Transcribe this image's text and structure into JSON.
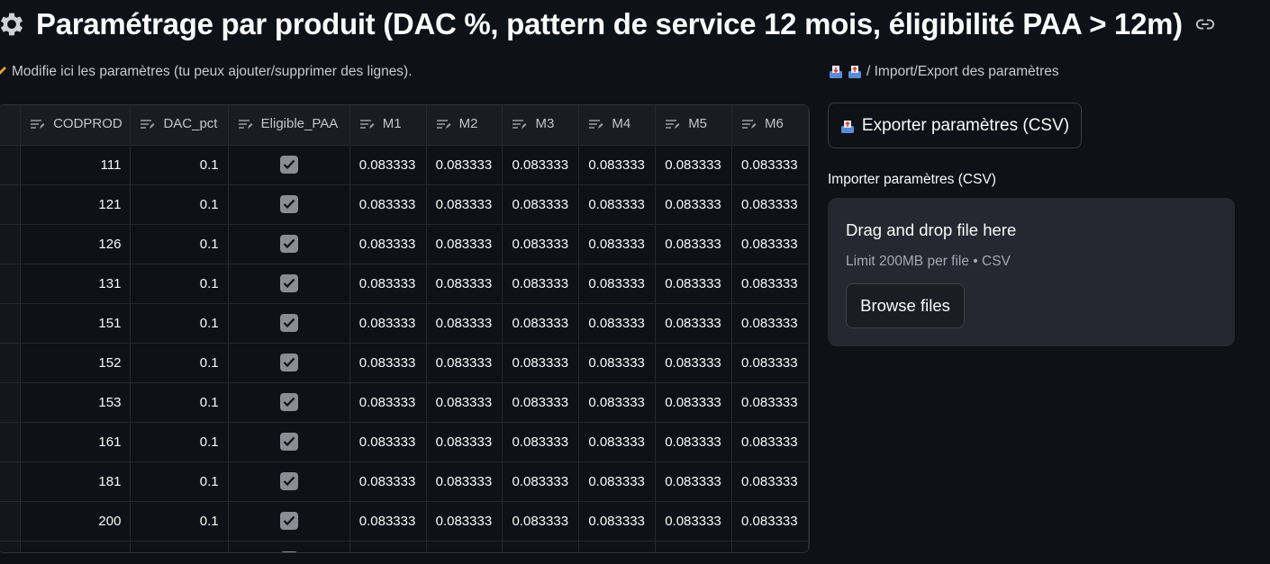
{
  "header": {
    "title": "Paramétrage par produit (DAC %, pattern de service 12 mois, éligibilité PAA > 12m)",
    "title_icon": "gear-icon",
    "link_icon": "link-icon"
  },
  "editor": {
    "caption": "Modifie ici les paramètres (tu peux ajouter/supprimer des lignes).",
    "caption_icon": "pencil-icon",
    "columns": [
      "CODPROD",
      "DAC_pct",
      "Eligible_PAA",
      "M1",
      "M2",
      "M3",
      "M4",
      "M5",
      "M6"
    ],
    "rows": [
      {
        "codprod": "111",
        "dac": "0.1",
        "eligible": true,
        "m": [
          "0.083333",
          "0.083333",
          "0.083333",
          "0.083333",
          "0.083333",
          "0.083333"
        ]
      },
      {
        "codprod": "121",
        "dac": "0.1",
        "eligible": true,
        "m": [
          "0.083333",
          "0.083333",
          "0.083333",
          "0.083333",
          "0.083333",
          "0.083333"
        ]
      },
      {
        "codprod": "126",
        "dac": "0.1",
        "eligible": true,
        "m": [
          "0.083333",
          "0.083333",
          "0.083333",
          "0.083333",
          "0.083333",
          "0.083333"
        ]
      },
      {
        "codprod": "131",
        "dac": "0.1",
        "eligible": true,
        "m": [
          "0.083333",
          "0.083333",
          "0.083333",
          "0.083333",
          "0.083333",
          "0.083333"
        ]
      },
      {
        "codprod": "151",
        "dac": "0.1",
        "eligible": true,
        "m": [
          "0.083333",
          "0.083333",
          "0.083333",
          "0.083333",
          "0.083333",
          "0.083333"
        ]
      },
      {
        "codprod": "152",
        "dac": "0.1",
        "eligible": true,
        "m": [
          "0.083333",
          "0.083333",
          "0.083333",
          "0.083333",
          "0.083333",
          "0.083333"
        ]
      },
      {
        "codprod": "153",
        "dac": "0.1",
        "eligible": true,
        "m": [
          "0.083333",
          "0.083333",
          "0.083333",
          "0.083333",
          "0.083333",
          "0.083333"
        ]
      },
      {
        "codprod": "161",
        "dac": "0.1",
        "eligible": true,
        "m": [
          "0.083333",
          "0.083333",
          "0.083333",
          "0.083333",
          "0.083333",
          "0.083333"
        ]
      },
      {
        "codprod": "181",
        "dac": "0.1",
        "eligible": true,
        "m": [
          "0.083333",
          "0.083333",
          "0.083333",
          "0.083333",
          "0.083333",
          "0.083333"
        ]
      },
      {
        "codprod": "200",
        "dac": "0.1",
        "eligible": true,
        "m": [
          "0.083333",
          "0.083333",
          "0.083333",
          "0.083333",
          "0.083333",
          "0.083333"
        ]
      },
      {
        "codprod": "",
        "dac": "",
        "eligible": true,
        "m": [
          "",
          "",
          "",
          "",
          "",
          ""
        ]
      }
    ]
  },
  "io": {
    "caption": "/ Import/Export des paramètres",
    "export_label": "Exporter paramètres (CSV)",
    "import_label": "Importer paramètres (CSV)",
    "dropzone_title": "Drag and drop file here",
    "dropzone_limit": "Limit 200MB per file • CSV",
    "browse_label": "Browse files"
  },
  "colors": {
    "background": "#0e1117",
    "grid_header": "#1a1c23",
    "dropzone": "#262730",
    "checkbox": "#8a8d95"
  }
}
